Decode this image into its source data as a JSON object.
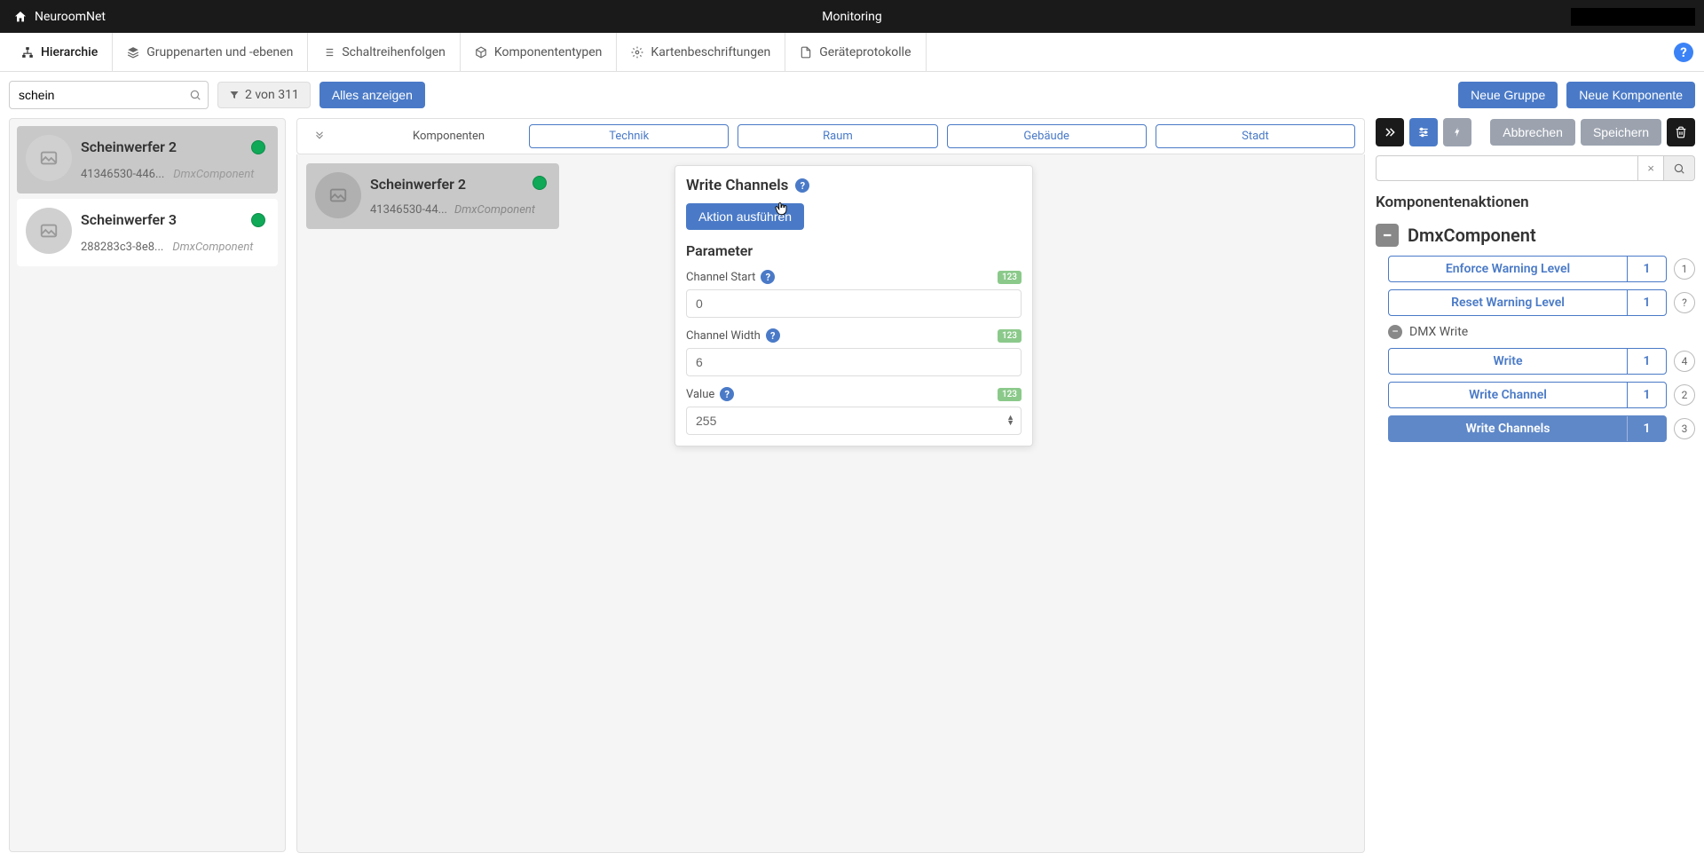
{
  "topbar": {
    "brand": "NeuroomNet",
    "title": "Monitoring"
  },
  "nav": {
    "tabs": [
      {
        "label": "Hierarchie"
      },
      {
        "label": "Gruppenarten und -ebenen"
      },
      {
        "label": "Schaltreihenfolgen"
      },
      {
        "label": "Komponententypen"
      },
      {
        "label": "Kartenbeschriftungen"
      },
      {
        "label": "Geräteprotokolle"
      }
    ]
  },
  "toolbar": {
    "search_value": "schein",
    "filter_text": "2 von 311",
    "show_all": "Alles anzeigen",
    "new_group": "Neue Gruppe",
    "new_component": "Neue Komponente"
  },
  "left_list": [
    {
      "title": "Scheinwerfer 2",
      "id": "41346530-446...",
      "type": "DmxComponent",
      "active": true
    },
    {
      "title": "Scheinwerfer 3",
      "id": "288283c3-8e8...",
      "type": "DmxComponent",
      "active": false
    }
  ],
  "middle": {
    "komponenten_label": "Komponenten",
    "levels": [
      "Technik",
      "Raum",
      "Gebäude",
      "Stadt"
    ],
    "card": {
      "title": "Scheinwerfer 2",
      "id": "41346530-44...",
      "type": "DmxComponent"
    }
  },
  "popup": {
    "title": "Write Channels",
    "execute": "Aktion ausführen",
    "param_header": "Parameter",
    "params": [
      {
        "label": "Channel Start",
        "value": "0"
      },
      {
        "label": "Channel Width",
        "value": "6"
      },
      {
        "label": "Value",
        "value": "255",
        "spinner": true
      }
    ],
    "badge": "123"
  },
  "right": {
    "cancel": "Abbrechen",
    "save": "Speichern",
    "section_title": "Komponentenaktionen",
    "component_type": "DmxComponent",
    "sub_group": "DMX Write",
    "actions_top": [
      {
        "name": "Enforce Warning Level",
        "count": "1",
        "badge": "1"
      },
      {
        "name": "Reset Warning Level",
        "count": "1",
        "badge": "?"
      }
    ],
    "actions_sub": [
      {
        "name": "Write",
        "count": "1",
        "badge": "4"
      },
      {
        "name": "Write Channel",
        "count": "1",
        "badge": "2"
      },
      {
        "name": "Write Channels",
        "count": "1",
        "badge": "3",
        "selected": true
      }
    ]
  }
}
